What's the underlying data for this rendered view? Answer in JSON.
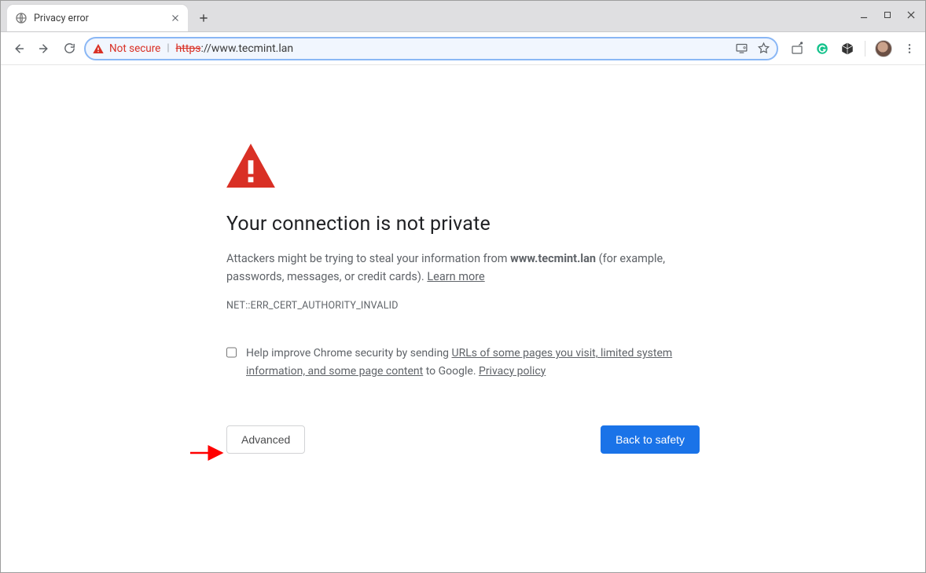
{
  "tab": {
    "title": "Privacy error"
  },
  "omnibox": {
    "security_label": "Not secure",
    "url_protocol_strike": "https",
    "url_rest": "://www.tecmint.lan"
  },
  "page": {
    "headline": "Your connection is not private",
    "para_prefix": "Attackers might be trying to steal your information from ",
    "domain": "www.tecmint.lan",
    "para_suffix": " (for example, passwords, messages, or credit cards). ",
    "learn_more": "Learn more",
    "error_code": "NET::ERR_CERT_AUTHORITY_INVALID",
    "optin_prefix": "Help improve Chrome security by sending ",
    "optin_link1": "URLs of some pages you visit, limited system information, and some page content",
    "optin_mid": " to Google. ",
    "optin_link2": "Privacy policy",
    "advanced_label": "Advanced",
    "safety_label": "Back to safety"
  }
}
